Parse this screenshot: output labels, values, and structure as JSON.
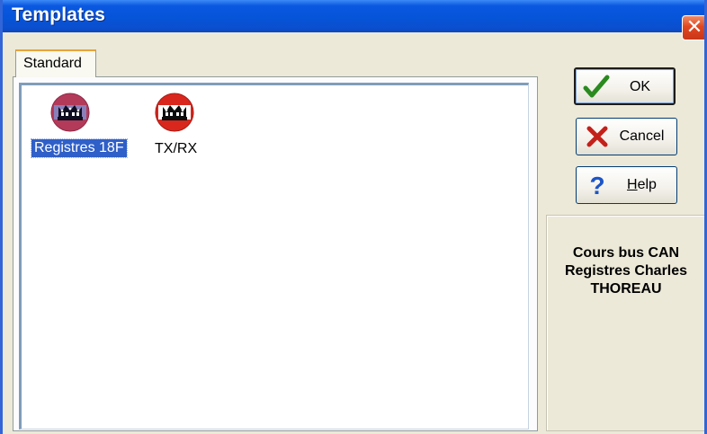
{
  "window": {
    "title": "Templates",
    "close_glyph": "✕"
  },
  "tabs": [
    {
      "label": "Standard",
      "active": true
    }
  ],
  "templates": [
    {
      "label": "Registres 18F",
      "icon": "crown-logo-icon",
      "selected": true,
      "icon_color": "#b43a5a"
    },
    {
      "label": "TX/RX",
      "icon": "crown-logo-icon",
      "selected": false,
      "icon_color": "#d9271e"
    }
  ],
  "buttons": {
    "ok": {
      "label": "OK",
      "icon": "checkmark-icon"
    },
    "cancel": {
      "label": "Cancel",
      "icon": "x-icon"
    },
    "help": {
      "label": "Help",
      "icon": "question-icon"
    }
  },
  "description": {
    "lines": [
      "Cours bus CAN",
      "Registres Charles",
      "THOREAU"
    ]
  },
  "colors": {
    "title_bar": "#0a58e0",
    "selection": "#2f5fc8",
    "close_button": "#e1471f",
    "checkmark": "#2a8a1f",
    "cancel_x": "#c4201a",
    "help_question": "#1c55c8"
  }
}
